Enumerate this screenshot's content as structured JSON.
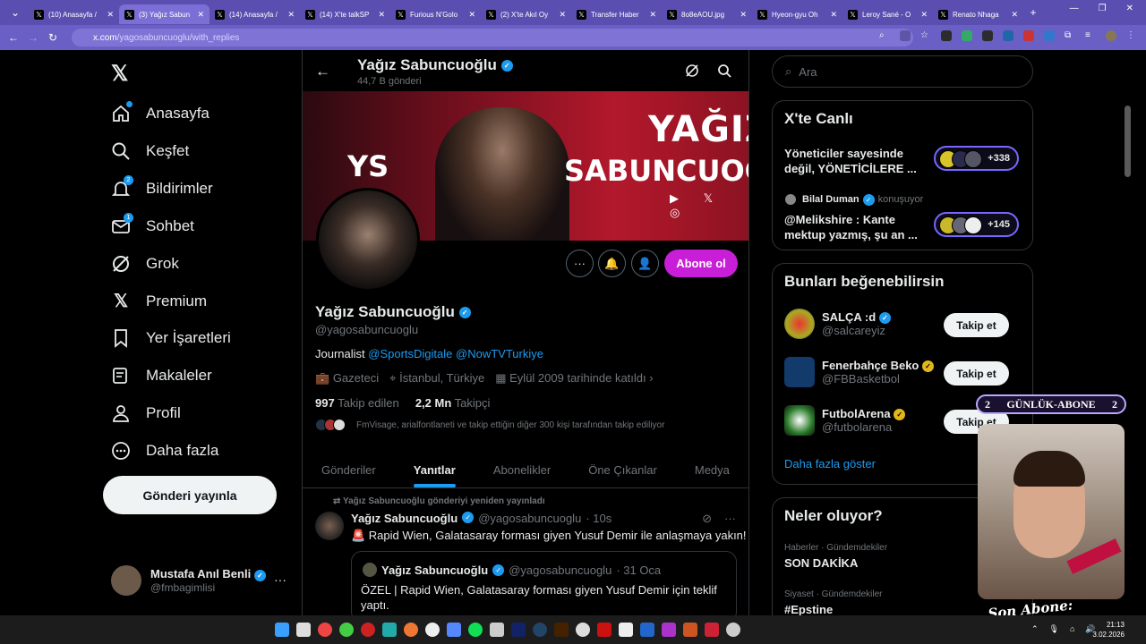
{
  "browser": {
    "tabs": [
      {
        "label": "(10) Anasayfa /",
        "active": false
      },
      {
        "label": "(3) Yağız Sabun",
        "active": true
      },
      {
        "label": "(14) Anasayfa /",
        "active": false
      },
      {
        "label": "(14) X'te talkSP",
        "active": false
      },
      {
        "label": "Furious N'Golo",
        "active": false
      },
      {
        "label": "(2) X'te Akıl Oy",
        "active": false
      },
      {
        "label": "Transfer Haber",
        "active": false
      },
      {
        "label": "8o8eAOU.jpg",
        "active": false
      },
      {
        "label": "Hyeon-gyu Oh",
        "active": false
      },
      {
        "label": "Leroy Sané - O",
        "active": false
      },
      {
        "label": "Renato Nhaga",
        "active": false
      }
    ],
    "url_host": "x.com",
    "url_path": "/yagosabuncuoglu/with_replies"
  },
  "sidebar": {
    "items": [
      {
        "label": "Anasayfa",
        "icon": "home-icon",
        "badge": ""
      },
      {
        "label": "Keşfet",
        "icon": "search-icon",
        "badge": ""
      },
      {
        "label": "Bildirimler",
        "icon": "bell-icon",
        "badge": "2"
      },
      {
        "label": "Sohbet",
        "icon": "mail-icon",
        "badge": "1"
      },
      {
        "label": "Grok",
        "icon": "grok-icon",
        "badge": ""
      },
      {
        "label": "Premium",
        "icon": "x-icon",
        "badge": ""
      },
      {
        "label": "Yer İşaretleri",
        "icon": "bookmark-icon",
        "badge": ""
      },
      {
        "label": "Makaleler",
        "icon": "article-icon",
        "badge": ""
      },
      {
        "label": "Profil",
        "icon": "person-icon",
        "badge": ""
      },
      {
        "label": "Daha fazla",
        "icon": "more-circle-icon",
        "badge": ""
      }
    ],
    "post_button": "Gönderi yayınla",
    "account": {
      "name": "Mustafa Anıl Benli",
      "handle": "@fmbagimlisi"
    }
  },
  "profile": {
    "header_name": "Yağız Sabuncuoğlu",
    "post_count": "44,7 B gönderi",
    "banner_line1": "YAĞIZ",
    "banner_line2": "SABUNCUOĞLU",
    "banner_logo": "YS",
    "subscribe": "Abone ol",
    "name": "Yağız Sabuncuoğlu",
    "handle": "@yagosabuncuoglu",
    "bio_prefix": "Journalist",
    "bio_link1": "@SportsDigitale",
    "bio_link2": "@NowTVTurkiye",
    "job": "Gazeteci",
    "location": "İstanbul, Türkiye",
    "joined": "Eylül 2009 tarihinde katıldı",
    "following_count": "997",
    "following_label": "Takip edilen",
    "followers_count": "2,2 Mn",
    "followers_label": "Takipçi",
    "followed_by": "FmVisage, arialfontlaneti ve takip ettiğin diğer 300 kişi tarafından takip ediliyor"
  },
  "tabs": [
    "Gönderiler",
    "Yanıtlar",
    "Abonelikler",
    "Öne Çıkanlar",
    "Medya"
  ],
  "active_tab": "Yanıtlar",
  "tweet": {
    "repost_note": "Yağız Sabuncuoğlu gönderiyi yeniden yayınladı",
    "name": "Yağız Sabuncuoğlu",
    "handle": "@yagosabuncuoglu",
    "time": "· 10s",
    "text": "🚨 Rapid Wien, Galatasaray forması giyen Yusuf Demir ile anlaşmaya yakın!",
    "quote": {
      "name": "Yağız Sabuncuoğlu",
      "handle": "@yagosabuncuoglu",
      "time": "· 31 Oca",
      "text": "ÖZEL | Rapid Wien, Galatasaray forması giyen Yusuf Demir için teklif yaptı."
    }
  },
  "right": {
    "search_placeholder": "Ara",
    "live": {
      "title": "X'te Canlı",
      "item1": "Yöneticiler sayesinde değil, YÖNETİCİLERE ...",
      "item1_count": "+338",
      "speaker_name": "Bilal Duman",
      "speaker_status": "konuşuyor",
      "item2": "@Melikshire : Kante mektup yazmış, şu an ...",
      "item2_count": "+145"
    },
    "suggest": {
      "title": "Bunları beğenebilirsin",
      "users": [
        {
          "name": "SALÇA :d",
          "handle": "@salcareyiz",
          "badge": "blue"
        },
        {
          "name": "Fenerbahçe Beko",
          "handle": "@FBBasketbol",
          "badge": "gold"
        },
        {
          "name": "FutbolArena",
          "handle": "@futbolarena",
          "badge": "gold"
        }
      ],
      "follow_label": "Takip et",
      "more": "Daha fazla göster"
    },
    "trends": {
      "title": "Neler oluyor?",
      "items": [
        {
          "context": "Haberler · Gündemdekiler",
          "topic": "SON DAKİKA"
        },
        {
          "context": "Siyaset · Gündemdekiler",
          "topic": "#Epstine"
        }
      ]
    }
  },
  "overlay": {
    "gunluk_left": "2",
    "gunluk_label": "GÜNLÜK-ABONE",
    "gunluk_right": "2",
    "son_abone": "Son Abone: cemgonte"
  },
  "taskbar": {
    "time": "21:13",
    "date": "3.02.2026"
  },
  "colors": {
    "accent": "#1d9bf0",
    "subscribe": "#c81ed8",
    "browser": "#5a4fb0"
  }
}
